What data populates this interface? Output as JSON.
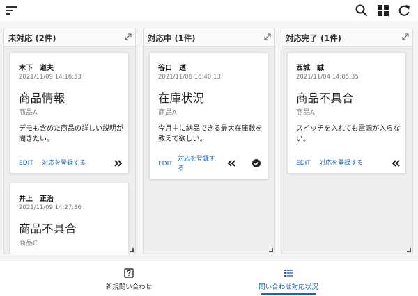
{
  "toolbar": {
    "menu_icon": "sort-menu-icon",
    "actions": [
      "search-icon",
      "grid-view-icon",
      "refresh-icon"
    ]
  },
  "columns": [
    {
      "title": "未対応 (2件)",
      "cards": [
        {
          "name": "木下　道夫",
          "time": "2021/11/09 14:16:53",
          "subject": "商品情報",
          "product": "商品A",
          "description": "デモも含めた商品の詳しい説明が聞きたい。",
          "edit_label": "EDIT",
          "register_label": "対応を登録する",
          "actions": [
            "double-chevron-right-icon"
          ]
        },
        {
          "name": "井上　正治",
          "time": "2021/11/09 14:27:36",
          "subject": "商品不具合",
          "product": "商品C"
        }
      ]
    },
    {
      "title": "対応中 (1件)",
      "cards": [
        {
          "name": "谷口　透",
          "time": "2021/11/06 16:40:13",
          "subject": "在庫状況",
          "product": "商品A",
          "description": "今月中に納品できる最大在庫数を教えて欲しい。",
          "edit_label": "EDIT",
          "register_label": "対応を登録する",
          "actions": [
            "double-chevron-left-icon",
            "check-circle-icon"
          ]
        }
      ]
    },
    {
      "title": "対応完了 (1件)",
      "cards": [
        {
          "name": "西城　誠",
          "time": "2021/11/04 14:05:35",
          "subject": "商品不具合",
          "product": "商品A",
          "description": "スイッチを入れても電源が入らない。",
          "edit_label": "EDIT",
          "register_label": "対応を登録する",
          "actions": [
            "double-chevron-left-icon"
          ]
        }
      ]
    }
  ],
  "bottom_nav": [
    {
      "label": "新規問い合わせ",
      "icon": "help-box-icon",
      "active": false
    },
    {
      "label": "問い合わせ対応状況",
      "icon": "list-icon",
      "active": true
    }
  ],
  "colors": {
    "accent": "#1565c0",
    "board_background": "#eeeeee",
    "text": "#212121"
  }
}
